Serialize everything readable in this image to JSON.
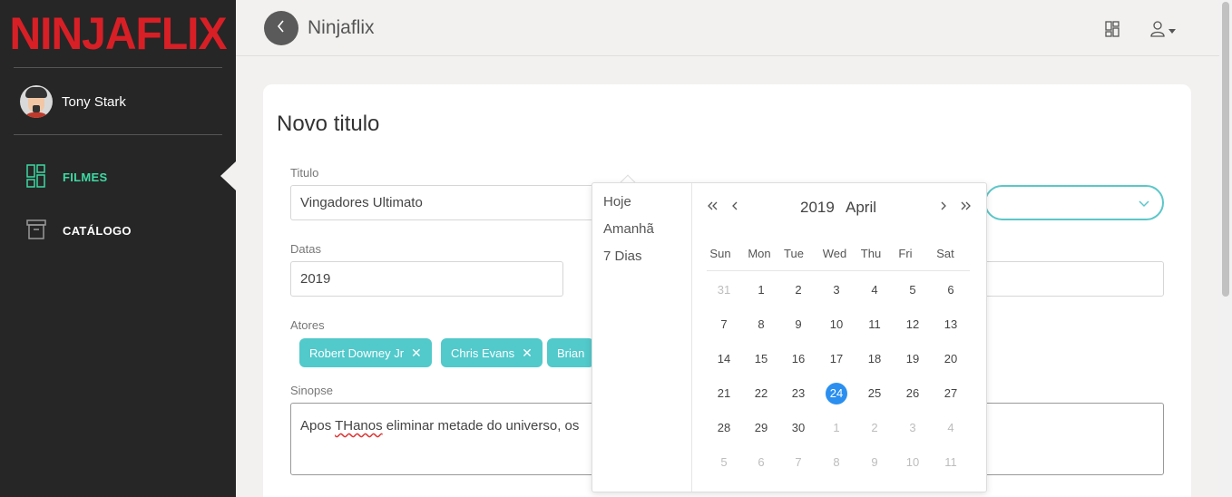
{
  "sidebar": {
    "logo": "NINJAFLIX",
    "user_name": "Tony Stark",
    "items": [
      {
        "label": "FILMES",
        "icon": "dashboard-icon",
        "active": true
      },
      {
        "label": "CATÁLOGO",
        "icon": "archive-icon",
        "active": false
      }
    ]
  },
  "topbar": {
    "title": "Ninjaflix"
  },
  "form": {
    "heading": "Novo titulo",
    "title_label": "Titulo",
    "title_value": "Vingadores Ultimato",
    "dates_label": "Datas",
    "dates_value": "2019",
    "actors_label": "Atores",
    "actors": [
      "Robert Downey Jr",
      "Chris Evans",
      "Brian"
    ],
    "synopsis_label": "Sinopse",
    "synopsis_before": "Apos ",
    "synopsis_misspelled": "THanos",
    "synopsis_after": " eliminar metade do universo, os"
  },
  "datepicker": {
    "presets": [
      "Hoje",
      "Amanhã",
      "7 Dias"
    ],
    "year": "2019",
    "month": "April",
    "weekdays": [
      "Sun",
      "Mon",
      "Tue",
      "Wed",
      "Thu",
      "Fri",
      "Sat"
    ],
    "weeks": [
      [
        "31",
        "1",
        "2",
        "3",
        "4",
        "5",
        "6"
      ],
      [
        "7",
        "8",
        "9",
        "10",
        "11",
        "12",
        "13"
      ],
      [
        "14",
        "15",
        "16",
        "17",
        "18",
        "19",
        "20"
      ],
      [
        "21",
        "22",
        "23",
        "24",
        "25",
        "26",
        "27"
      ],
      [
        "28",
        "29",
        "30",
        "1",
        "2",
        "3",
        "4"
      ],
      [
        "5",
        "6",
        "7",
        "8",
        "9",
        "10",
        "11"
      ]
    ],
    "selected": "24",
    "accent": "#2b8ff0"
  },
  "colors": {
    "brand": "#d81f26",
    "active_nav": "#3ed9a3",
    "chip": "#52c9cb"
  }
}
